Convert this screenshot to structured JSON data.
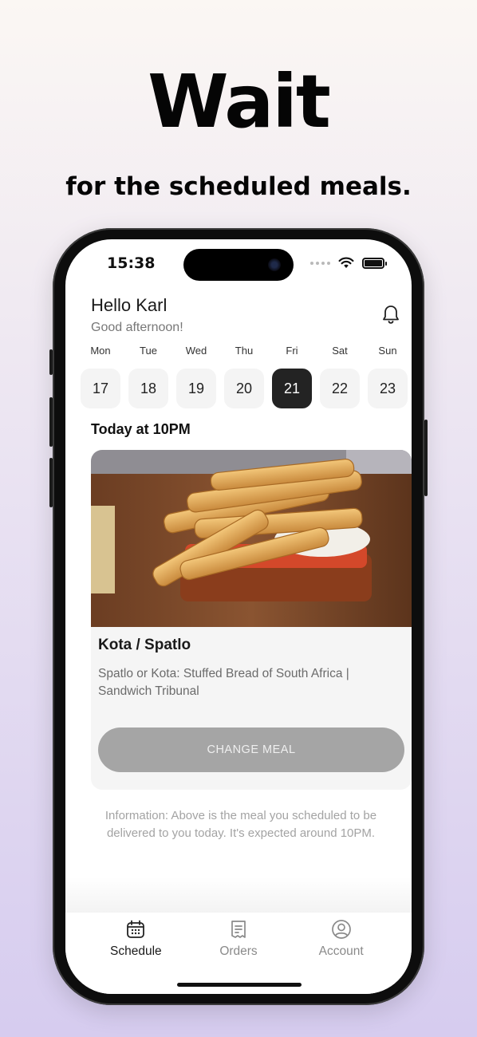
{
  "promo": {
    "headline": "Wait",
    "subheadline": "for the scheduled meals."
  },
  "status_bar": {
    "time": "15:38"
  },
  "header": {
    "greeting": "Hello Karl",
    "subgreeting": "Good afternoon!",
    "notification_icon": "bell-icon"
  },
  "calendar": {
    "weekdays": [
      "Mon",
      "Tue",
      "Wed",
      "Thu",
      "Fri",
      "Sat",
      "Sun"
    ],
    "dates": [
      "17",
      "18",
      "19",
      "20",
      "21",
      "22",
      "23"
    ],
    "selected_date": "21"
  },
  "schedule": {
    "title": "Today at 10PM",
    "meal": {
      "name": "Kota / Spatlo",
      "description": "Spatlo or Kota: Stuffed Bread of South Africa | Sandwich Tribunal",
      "change_label": "CHANGE MEAL"
    },
    "info": "Information: Above is the meal you scheduled to be delivered to you  today. It's expected around 10PM."
  },
  "tabbar": {
    "items": [
      {
        "label": "Schedule",
        "icon": "calendar-icon",
        "active": true
      },
      {
        "label": "Orders",
        "icon": "receipt-icon",
        "active": false
      },
      {
        "label": "Account",
        "icon": "user-circle-icon",
        "active": false
      }
    ]
  },
  "colors": {
    "accent": "#232323",
    "button_disabled": "#a5a5a5",
    "background_top": "#fbf7f3",
    "background_bottom": "#d6ccef"
  }
}
